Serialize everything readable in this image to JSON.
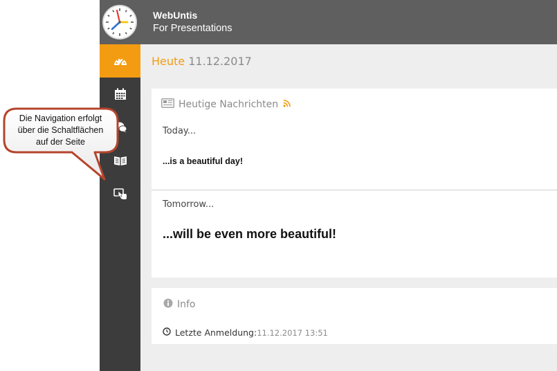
{
  "header": {
    "title": "WebUntis",
    "subtitle": "For Presentations"
  },
  "sidebar": {
    "items": [
      {
        "name": "dashboard",
        "icon": "speedometer-icon",
        "active": true
      },
      {
        "name": "timetable",
        "icon": "calendar-icon",
        "active": false
      },
      {
        "name": "messages",
        "icon": "chat-bubbles-icon",
        "active": false
      },
      {
        "name": "classbook",
        "icon": "open-book-icon",
        "active": false
      },
      {
        "name": "other",
        "icon": "hand-tap-icon",
        "active": false
      }
    ]
  },
  "main": {
    "title_prefix": "Heute",
    "title_date": "11.12.2017",
    "news": {
      "heading": "Heutige Nachrichten",
      "item1_line1": "Today...",
      "item1_line2": "...is a beautiful day!",
      "item2_line1": "Tomorrow...",
      "item2_line2": "...will be even more beautiful!"
    },
    "info": {
      "heading": "Info",
      "last_login_label": "Letzte Anmeldung:",
      "last_login_value": "11.12.2017 13:51"
    }
  },
  "callout": {
    "line1": "Die Navigation erfolgt",
    "line2": "über die Schaltflächen",
    "line3": "auf der Seite"
  },
  "colors": {
    "accent": "#f39c12",
    "header_bg": "#5f5f5f",
    "sidebar_bg": "#3c3c3c",
    "callout_border": "#b5442c"
  }
}
